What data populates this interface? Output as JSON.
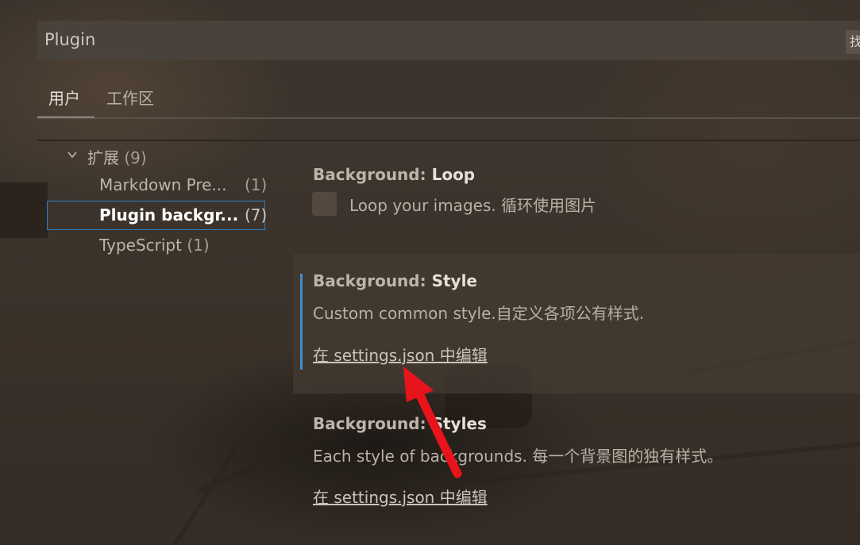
{
  "search": {
    "value": "Plugin",
    "side_button_label": "找"
  },
  "tabs": [
    {
      "label": "用户",
      "active": true
    },
    {
      "label": "工作区",
      "active": false
    }
  ],
  "tree": {
    "group": {
      "label": "扩展",
      "count": "(9)",
      "expanded": true
    },
    "items": [
      {
        "label": "Markdown Pre...",
        "count": "(1)"
      },
      {
        "label": "Plugin backgr...",
        "count": "(7)",
        "selected": true
      },
      {
        "label": "TypeScript",
        "count": "(1)"
      }
    ]
  },
  "settings": [
    {
      "category": "Background: ",
      "name": "Loop",
      "description": "Loop your images. 循环使用图片",
      "checked": false
    },
    {
      "category": "Background: ",
      "name": "Style",
      "description": "Custom common style.自定义各项公有样式.",
      "edit_link": "在 settings.json 中编辑"
    },
    {
      "category": "Background: ",
      "name": "Styles",
      "description": "Each style of backgrounds. 每一个背景图的独有样式。",
      "edit_link": "在 settings.json 中编辑"
    }
  ],
  "colors": {
    "focus_accent": "#3f8fcf",
    "selection_border": "#2f7fbf",
    "annotation_arrow": "#e8141c"
  }
}
